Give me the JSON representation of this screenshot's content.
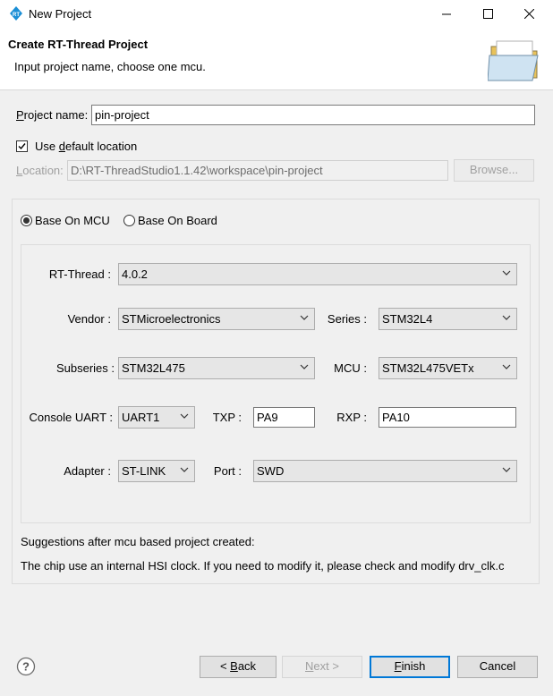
{
  "window": {
    "title": "New Project"
  },
  "header": {
    "title": "Create RT-Thread Project",
    "description": "Input project name, choose one mcu."
  },
  "project": {
    "name_label": "Project name:",
    "name_value": "pin-project",
    "use_default_label": "Use default location",
    "use_default_checked": true,
    "location_label": "Location:",
    "location_value": "D:\\RT-ThreadStudio1.1.42\\workspace\\pin-project",
    "browse_label": "Browse..."
  },
  "mode": {
    "mcu_label": "Base On MCU",
    "board_label": "Base On Board",
    "selected": "mcu"
  },
  "mcu": {
    "rtthread_label": "RT-Thread :",
    "rtthread_value": "4.0.2",
    "vendor_label": "Vendor :",
    "vendor_value": "STMicroelectronics",
    "series_label": "Series :",
    "series_value": "STM32L4",
    "subseries_label": "Subseries :",
    "subseries_value": "STM32L475",
    "mcu_label": "MCU :",
    "mcu_value": "STM32L475VETx",
    "console_label": "Console UART :",
    "console_value": "UART1",
    "txp_label": "TXP :",
    "txp_value": "PA9",
    "rxp_label": "RXP :",
    "rxp_value": "PA10",
    "adapter_label": "Adapter :",
    "adapter_value": "ST-LINK",
    "port_label": "Port :",
    "port_value": "SWD"
  },
  "suggestions": {
    "title": "Suggestions after mcu based project created:",
    "text": "The chip use an internal HSI clock. If you need to modify it, please check and modify drv_clk.c"
  },
  "footer": {
    "back_label": "< Back",
    "next_label": "Next >",
    "finish_label": "Finish",
    "cancel_label": "Cancel"
  }
}
